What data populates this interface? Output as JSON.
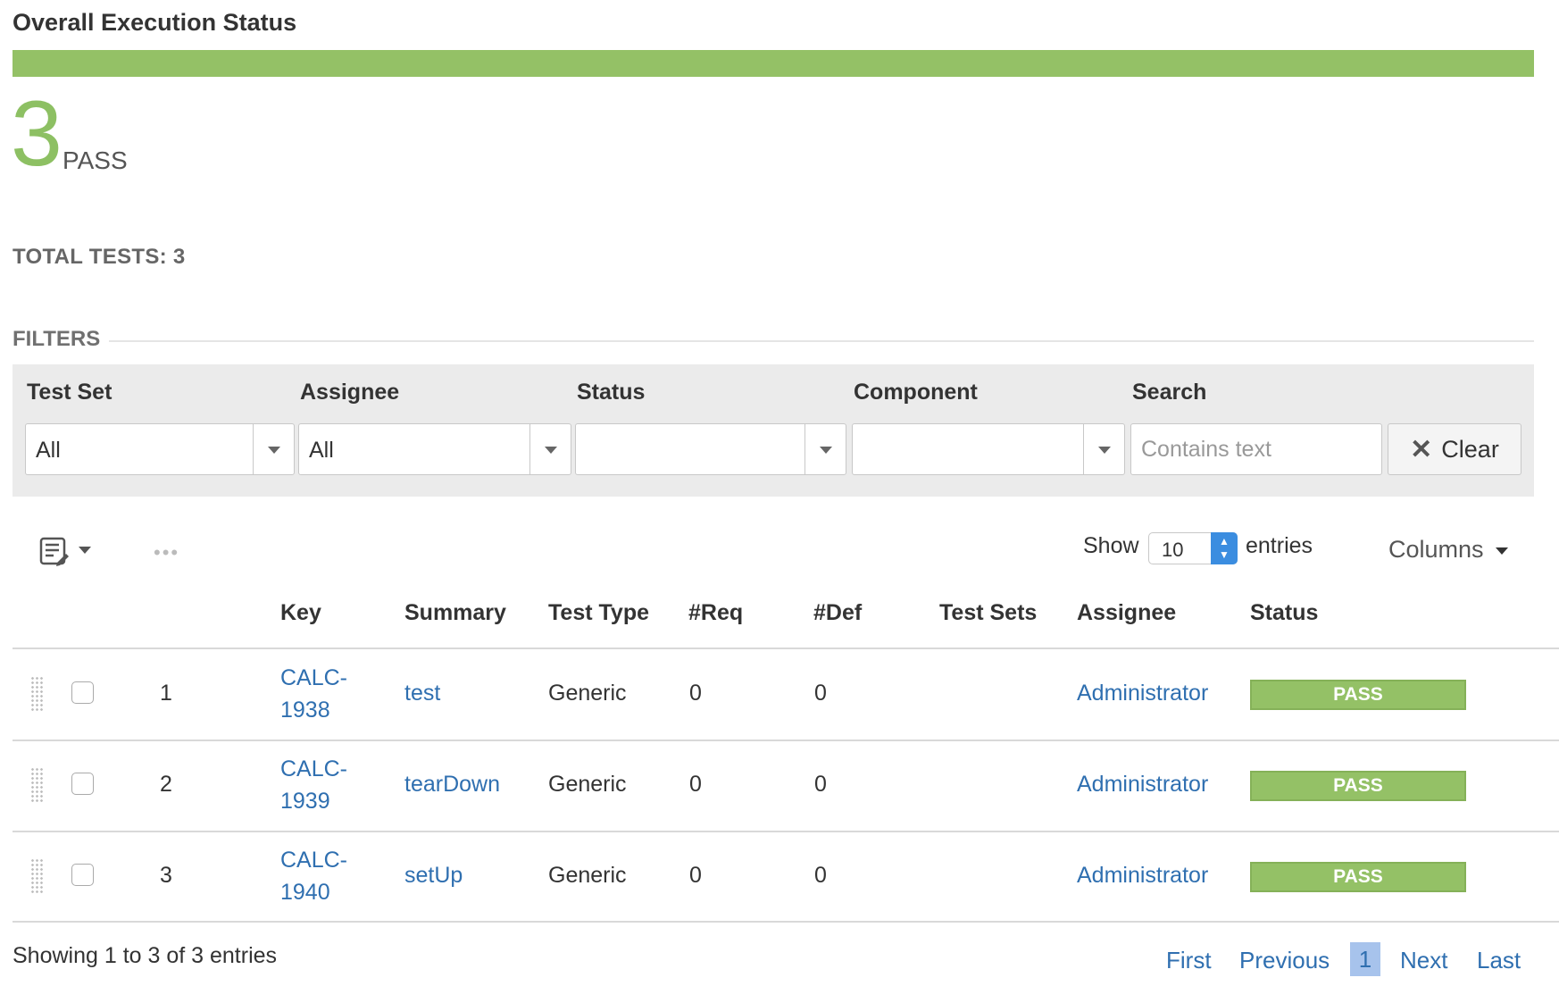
{
  "header": {
    "title": "Overall Execution Status",
    "status_color": "#94c166"
  },
  "summary": {
    "count": "3",
    "count_label": "PASS",
    "total_tests": "TOTAL TESTS: 3"
  },
  "filters": {
    "heading": "FILTERS",
    "test_set": {
      "label": "Test Set",
      "value": "All"
    },
    "assignee": {
      "label": "Assignee",
      "value": "All"
    },
    "status": {
      "label": "Status",
      "value": ""
    },
    "component": {
      "label": "Component",
      "value": ""
    },
    "search": {
      "label": "Search",
      "placeholder": "Contains text",
      "value": ""
    },
    "clear_label": "Clear"
  },
  "table_controls": {
    "show_label": "Show",
    "page_size": "10",
    "entries_label": "entries",
    "columns_label": "Columns",
    "more_dots": "•••"
  },
  "table": {
    "columns": [
      "Key",
      "Summary",
      "Test Type",
      "#Req",
      "#Def",
      "Test Sets",
      "Assignee",
      "Status"
    ],
    "rows": [
      {
        "index": "1",
        "key_line1": "CALC-",
        "key_line2": "1938",
        "summary": "test",
        "test_type": "Generic",
        "req": "0",
        "def": "0",
        "test_sets": "",
        "assignee": "Administrator",
        "status": "PASS"
      },
      {
        "index": "2",
        "key_line1": "CALC-",
        "key_line2": "1939",
        "summary": "tearDown",
        "test_type": "Generic",
        "req": "0",
        "def": "0",
        "test_sets": "",
        "assignee": "Administrator",
        "status": "PASS"
      },
      {
        "index": "3",
        "key_line1": "CALC-",
        "key_line2": "1940",
        "summary": "setUp",
        "test_type": "Generic",
        "req": "0",
        "def": "0",
        "test_sets": "",
        "assignee": "Administrator",
        "status": "PASS"
      }
    ]
  },
  "footer": {
    "showing": "Showing 1 to 3 of 3 entries",
    "first": "First",
    "previous": "Previous",
    "current_page": "1",
    "next": "Next",
    "last": "Last"
  },
  "colors": {
    "pass": "#94c166",
    "link": "#2f6fb0",
    "current_page_bg": "#a7c3ec"
  },
  "icons": {
    "toolbar": "edit-list-icon",
    "clear": "close-icon",
    "drag": "drag-handle-icon"
  }
}
